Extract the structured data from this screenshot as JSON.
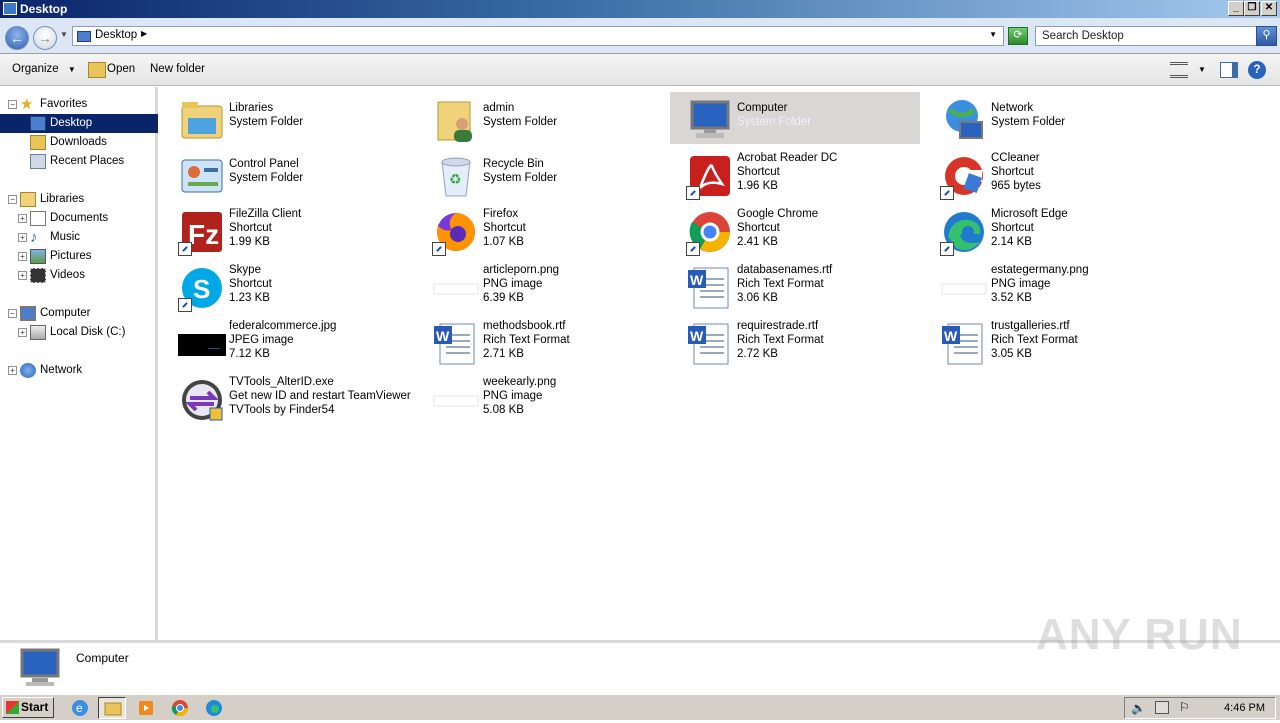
{
  "window": {
    "title": "Desktop"
  },
  "address": {
    "path": "Desktop",
    "search_placeholder": "Search Desktop"
  },
  "toolbar": {
    "organize": "Organize",
    "open": "Open",
    "new_folder": "New folder"
  },
  "nav": {
    "favorites": "Favorites",
    "desktop": "Desktop",
    "downloads": "Downloads",
    "recent": "Recent Places",
    "libraries": "Libraries",
    "documents": "Documents",
    "music": "Music",
    "pictures": "Pictures",
    "videos": "Videos",
    "computer": "Computer",
    "local_disk": "Local Disk (C:)",
    "network": "Network"
  },
  "items": [
    {
      "name": "Libraries",
      "type": "System Folder",
      "size": "",
      "icon": "libraries-icon"
    },
    {
      "name": "admin",
      "type": "System Folder",
      "size": "",
      "icon": "user-folder-icon"
    },
    {
      "name": "Computer",
      "type": "System Folder",
      "size": "",
      "icon": "computer-icon",
      "selected": true
    },
    {
      "name": "Network",
      "type": "System Folder",
      "size": "",
      "icon": "network-icon"
    },
    {
      "name": "Control Panel",
      "type": "System Folder",
      "size": "",
      "icon": "control-panel-icon"
    },
    {
      "name": "Recycle Bin",
      "type": "System Folder",
      "size": "",
      "icon": "recycle-bin-icon"
    },
    {
      "name": "Acrobat Reader DC",
      "type": "Shortcut",
      "size": "1.96 KB",
      "icon": "acrobat-icon"
    },
    {
      "name": "CCleaner",
      "type": "Shortcut",
      "size": "965 bytes",
      "icon": "ccleaner-icon"
    },
    {
      "name": "FileZilla Client",
      "type": "Shortcut",
      "size": "1.99 KB",
      "icon": "filezilla-icon"
    },
    {
      "name": "Firefox",
      "type": "Shortcut",
      "size": "1.07 KB",
      "icon": "firefox-icon"
    },
    {
      "name": "Google Chrome",
      "type": "Shortcut",
      "size": "2.41 KB",
      "icon": "chrome-icon"
    },
    {
      "name": "Microsoft Edge",
      "type": "Shortcut",
      "size": "2.14 KB",
      "icon": "edge-icon"
    },
    {
      "name": "Skype",
      "type": "Shortcut",
      "size": "1.23 KB",
      "icon": "skype-icon"
    },
    {
      "name": "articleporn.png",
      "type": "PNG image",
      "size": "6.39 KB",
      "icon": "png-thumb-icon"
    },
    {
      "name": "databasenames.rtf",
      "type": "Rich Text Format",
      "size": "3.06 KB",
      "icon": "wordpad-icon"
    },
    {
      "name": "estategermany.png",
      "type": "PNG image",
      "size": "3.52 KB",
      "icon": "png-thumb-icon"
    },
    {
      "name": "federalcommerce.jpg",
      "type": "JPEG image",
      "size": "7.12 KB",
      "icon": "jpg-thumb-icon"
    },
    {
      "name": "methodsbook.rtf",
      "type": "Rich Text Format",
      "size": "2.71 KB",
      "icon": "wordpad-icon"
    },
    {
      "name": "requirestrade.rtf",
      "type": "Rich Text Format",
      "size": "2.72 KB",
      "icon": "wordpad-icon"
    },
    {
      "name": "trustgalleries.rtf",
      "type": "Rich Text Format",
      "size": "3.05 KB",
      "icon": "wordpad-icon"
    },
    {
      "name": "TVTools_AlterID.exe",
      "type": "Get new ID and restart TeamViewer",
      "size": "TVTools by Finder54",
      "icon": "tvtools-icon"
    },
    {
      "name": "weekearly.png",
      "type": "PNG image",
      "size": "5.08 KB",
      "icon": "png-thumb-icon"
    }
  ],
  "details": {
    "label": "Computer"
  },
  "taskbar": {
    "start": "Start",
    "clock": "4:46 PM"
  },
  "watermark": "ANY RUN"
}
